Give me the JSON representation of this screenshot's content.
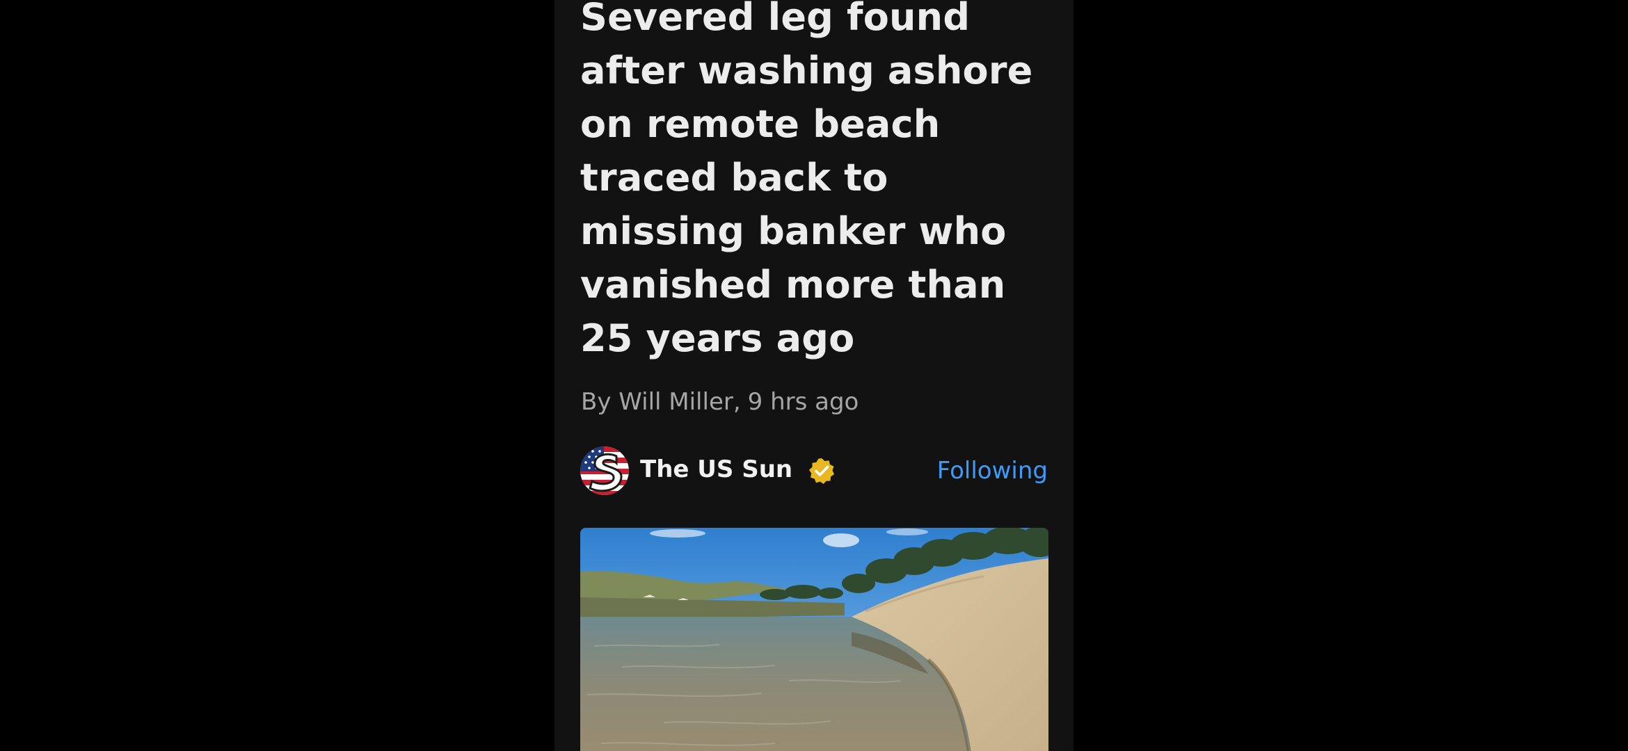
{
  "article": {
    "headline": "Severed leg found after washing ashore on remote beach traced back to missing banker who vanished more than 25 years ago",
    "author": "By Will Miller,",
    "time": "9 hrs ago"
  },
  "source": {
    "name": "The US Sun",
    "logo_icon": "us-sun-logo",
    "verified_icon": "verified-badge-icon",
    "follow_label": "Following"
  },
  "hero_image": {
    "description_icon": "beach-lagoon-photo"
  },
  "colors": {
    "background": "#121212",
    "headline": "#ececec",
    "byline": "#a6a6a6",
    "accent": "#3b9bff",
    "verified": "#e8b820"
  }
}
